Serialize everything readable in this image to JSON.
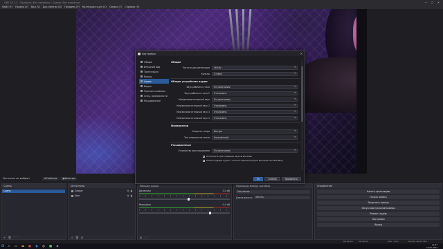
{
  "window": {
    "title": "OBS 30.1.2 - Профиль: Без названия - Сцены: Без названия",
    "controls": [
      "—",
      "▢",
      "✕"
    ]
  },
  "menu": [
    "Файл (F)",
    "Правка (E)",
    "Вид (V)",
    "Док-панели (D)",
    "Профиль (P)",
    "Коллекция сцен (S)",
    "Сервис (T)",
    "Справка (H)"
  ],
  "status_line": {
    "source_label": "Источник не выбран",
    "properties_btn": "Свойства",
    "filters_btn": "Фильтры"
  },
  "docks": {
    "scenes": {
      "title": "Сцены",
      "items": [
        "Сцена"
      ]
    },
    "sources": {
      "title": "Источники",
      "items": [
        "Захват",
        "Фон"
      ]
    },
    "mixer": {
      "title": "Микшер аудио",
      "channels": [
        {
          "name": "Динамики",
          "db": "0.0 dB",
          "level": 0.55
        },
        {
          "name": "Микрофон",
          "db": "0.0 dB",
          "level": 0.78
        }
      ]
    },
    "transitions": {
      "title": "Переходы между сценами",
      "type": "Затухание",
      "duration_label": "Длительность",
      "duration_value": "300 ms"
    },
    "controls": {
      "title": "Управление",
      "buttons": [
        "Начать трансляцию",
        "Начать запись",
        "Запустить повтор",
        "Запуск виртуальной камеры",
        "Режим студии",
        "Настройки",
        "Выход"
      ]
    }
  },
  "bottom_status": {
    "rec": "00:00:00",
    "stream": "00:00:00",
    "cpu": "CPU: 1.3%",
    "fps": "60.00 / 60.00 FPS"
  },
  "taskbar": {
    "time": "11:57",
    "date": "16.07.2024"
  },
  "dialog": {
    "title": "Настройки",
    "nav": [
      {
        "label": "Общие",
        "active": false
      },
      {
        "label": "Внешний вид",
        "active": false
      },
      {
        "label": "Трансляция",
        "active": false
      },
      {
        "label": "Вывод",
        "active": false
      },
      {
        "label": "Аудио",
        "active": true
      },
      {
        "label": "Видео",
        "active": false
      },
      {
        "label": "Горячие клавиши",
        "active": false
      },
      {
        "label": "Спец. возможности",
        "active": false
      },
      {
        "label": "Расширенные",
        "active": false
      }
    ],
    "general_section": "Общие",
    "sample_rate_label": "Частота дискретизации",
    "sample_rate_value": "48 kHz",
    "channels_label": "Каналы",
    "channels_value": "Стерео",
    "devices_section": "Общие устройства аудио",
    "devices": [
      {
        "label": "Звук рабочего стола",
        "value": "По умолчанию"
      },
      {
        "label": "Звук рабочего стола 2",
        "value": "Отключено"
      },
      {
        "label": "Мик/вспомогательный звук",
        "value": "По умолчанию"
      },
      {
        "label": "Мик/вспомогательный звук 2",
        "value": "Отключено"
      },
      {
        "label": "Мик/вспомогательный звук 3",
        "value": "Отключено"
      },
      {
        "label": "Мик/вспомогательный звук 4",
        "value": "Отключено"
      }
    ],
    "meters_section": "Измерители",
    "decay_label": "Скорость спада",
    "decay_value": "Быстро",
    "peak_label": "Тип измерителя пиков",
    "peak_value": "Упрощённый",
    "advanced_section": "Расширенные",
    "monitor_label": "Устройство прослушивания",
    "monitor_value": "По умолчанию",
    "check1": "Отключить приглушение звуков Windows",
    "check2": "Режим буфера аудио с низкой задержкой (для выходов Decklink/NDI)",
    "btn_ok": "OK",
    "btn_cancel": "Отмена",
    "btn_apply": "Применить"
  }
}
